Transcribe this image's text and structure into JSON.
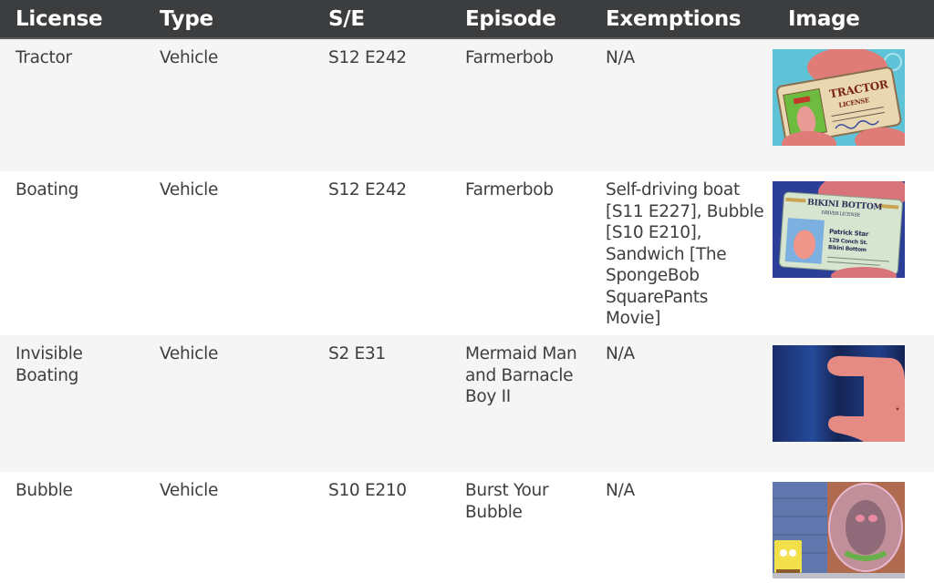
{
  "table": {
    "headers": [
      "License",
      "Type",
      "S/E",
      "Episode",
      "Exemptions",
      "Image"
    ],
    "rows": [
      {
        "license": "Tractor",
        "type": "Vehicle",
        "se": "S12 E242",
        "episode": "Farmerbob",
        "exemptions": "N/A",
        "image": {
          "alt": "Patrick holding a Tractor License card",
          "card_title": "TRACTOR",
          "card_subtitle": "LICENSE"
        }
      },
      {
        "license": "Boating",
        "type": "Vehicle",
        "se": "S12 E242",
        "episode": "Farmerbob",
        "exemptions": "Self-driving boat [S11 E227], Bubble [S10 E210], Sandwich [The SpongeBob SquarePants Movie]",
        "image": {
          "alt": "Patrick holding a Bikini Bottom driver license",
          "card_title": "BIKINI BOTTOM",
          "card_subtitle": "DRIVER LICENSE",
          "card_name": "Patrick Star",
          "card_address_1": "129 Conch St.",
          "card_address_2": "Bikini Bottom"
        }
      },
      {
        "license": "Invisible Boating",
        "type": "Vehicle",
        "se": "S2 E31",
        "episode": "Mermaid Man and Barnacle Boy II",
        "exemptions": "N/A",
        "image": {
          "alt": "Patrick's hand holding an invisible license"
        }
      },
      {
        "license": "Bubble",
        "type": "Vehicle",
        "se": "S10 E210",
        "episode": "Burst Your Bubble",
        "exemptions": "N/A",
        "image": {
          "alt": "SpongeBob and Patrick in a bubble"
        }
      }
    ]
  },
  "colors": {
    "header_bg": "#3c3d3f",
    "header_text": "#ffffff",
    "row_alt_bg": "#f5f5f5",
    "row_bg": "#ffffff",
    "body_text": "#3e3e3e"
  }
}
